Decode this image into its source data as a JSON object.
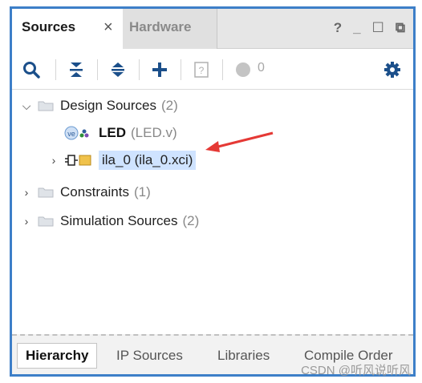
{
  "tabs": {
    "active": "Sources",
    "inactive": "Hardware",
    "close": "×"
  },
  "window_controls": {
    "help": "?",
    "minimize": "_",
    "maximize": "☐",
    "restore": "⧉"
  },
  "toolbar": {
    "icons": [
      "search-icon",
      "collapse-all-icon",
      "expand-all-icon",
      "add-icon",
      "unknown-icon",
      "status-dot-icon",
      "gear-icon"
    ],
    "count": "0"
  },
  "tree": {
    "design_sources": {
      "label": "Design Sources",
      "count": "(2)"
    },
    "led": {
      "label": "LED",
      "file": "(LED.v)"
    },
    "ila": {
      "label": "ila_0 (ila_0.xci)"
    },
    "constraints": {
      "label": "Constraints",
      "count": "(1)"
    },
    "simulation": {
      "label": "Simulation Sources",
      "count": "(2)"
    }
  },
  "bottom_tabs": [
    "Hierarchy",
    "IP Sources",
    "Libraries",
    "Compile Order"
  ],
  "watermark": "CSDN @听风说听风",
  "colors": {
    "frame": "#3d7fc8",
    "selection": "#cfe3ff",
    "arrow": "#e53935",
    "gear": "#1b4f8a"
  }
}
